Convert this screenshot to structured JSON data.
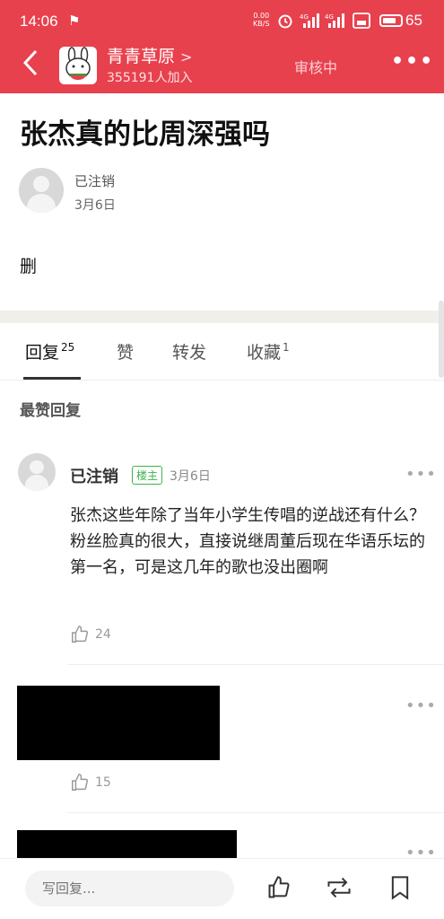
{
  "status_bar": {
    "time": "14:06",
    "net_speed_value": "0.00",
    "net_speed_unit": "KB/S",
    "battery": "65",
    "signal1": "4G",
    "signal2": "4G"
  },
  "header": {
    "group_name": "青青草原",
    "group_members": "355191人加入",
    "status": "审核中",
    "accent_color": "#e8414e"
  },
  "post": {
    "title": "张杰真的比周深强吗",
    "author": "已注销",
    "date": "3月6日",
    "body": "删"
  },
  "tabs": [
    {
      "label": "回复",
      "count": "25"
    },
    {
      "label": "赞",
      "count": ""
    },
    {
      "label": "转发",
      "count": ""
    },
    {
      "label": "收藏",
      "count": "1"
    }
  ],
  "section_label": "最赞回复",
  "comments": [
    {
      "author": "已注销",
      "badge": "楼主",
      "date": "3月6日",
      "text": "张杰这些年除了当年小学生传唱的逆战还有什么？粉丝脸真的很大，直接说继周董后现在华语乐坛的第一名，可是这几年的歌也没出圈啊",
      "likes": "24"
    },
    {
      "likes": "15"
    }
  ],
  "bottom_bar": {
    "reply_placeholder": "写回复..."
  }
}
